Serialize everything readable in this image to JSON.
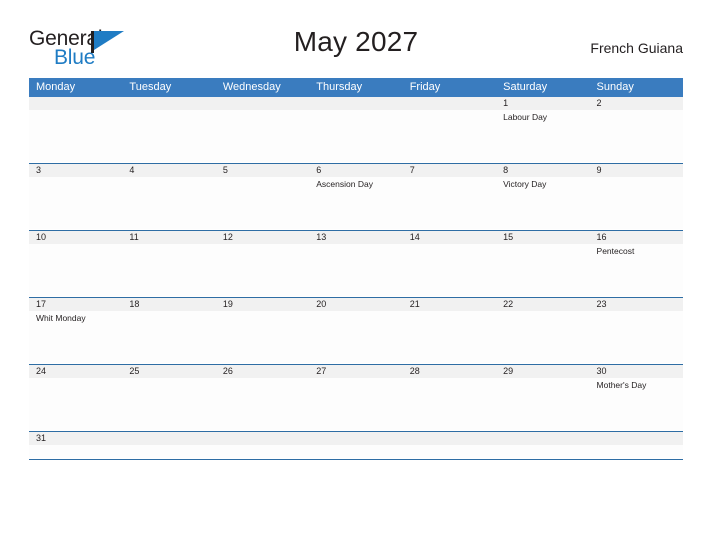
{
  "brand": {
    "name_part1": "General",
    "name_part2": "Blue",
    "flag_icon": "flag-triangle-icon",
    "accent_color": "#1f7cc4"
  },
  "header": {
    "title": "May 2027",
    "location": "French Guiana"
  },
  "theme": {
    "header_blue": "#3a7cbf",
    "row_border_blue": "#2e6da4",
    "date_band_gray": "#f1f1f1",
    "text_color": "#231f20"
  },
  "calendar": {
    "month": "May",
    "year": "2027",
    "weekday_headers": [
      "Monday",
      "Tuesday",
      "Wednesday",
      "Thursday",
      "Friday",
      "Saturday",
      "Sunday"
    ],
    "weeks": [
      {
        "days": [
          {
            "date": "",
            "event": ""
          },
          {
            "date": "",
            "event": ""
          },
          {
            "date": "",
            "event": ""
          },
          {
            "date": "",
            "event": ""
          },
          {
            "date": "",
            "event": ""
          },
          {
            "date": "1",
            "event": "Labour Day"
          },
          {
            "date": "2",
            "event": ""
          }
        ]
      },
      {
        "days": [
          {
            "date": "3",
            "event": ""
          },
          {
            "date": "4",
            "event": ""
          },
          {
            "date": "5",
            "event": ""
          },
          {
            "date": "6",
            "event": "Ascension Day"
          },
          {
            "date": "7",
            "event": ""
          },
          {
            "date": "8",
            "event": "Victory Day"
          },
          {
            "date": "9",
            "event": ""
          }
        ]
      },
      {
        "days": [
          {
            "date": "10",
            "event": ""
          },
          {
            "date": "11",
            "event": ""
          },
          {
            "date": "12",
            "event": ""
          },
          {
            "date": "13",
            "event": ""
          },
          {
            "date": "14",
            "event": ""
          },
          {
            "date": "15",
            "event": ""
          },
          {
            "date": "16",
            "event": "Pentecost"
          }
        ]
      },
      {
        "days": [
          {
            "date": "17",
            "event": "Whit Monday"
          },
          {
            "date": "18",
            "event": ""
          },
          {
            "date": "19",
            "event": ""
          },
          {
            "date": "20",
            "event": ""
          },
          {
            "date": "21",
            "event": ""
          },
          {
            "date": "22",
            "event": ""
          },
          {
            "date": "23",
            "event": ""
          }
        ]
      },
      {
        "days": [
          {
            "date": "24",
            "event": ""
          },
          {
            "date": "25",
            "event": ""
          },
          {
            "date": "26",
            "event": ""
          },
          {
            "date": "27",
            "event": ""
          },
          {
            "date": "28",
            "event": ""
          },
          {
            "date": "29",
            "event": ""
          },
          {
            "date": "30",
            "event": "Mother's Day"
          }
        ]
      },
      {
        "days": [
          {
            "date": "31",
            "event": ""
          },
          {
            "date": "",
            "event": ""
          },
          {
            "date": "",
            "event": ""
          },
          {
            "date": "",
            "event": ""
          },
          {
            "date": "",
            "event": ""
          },
          {
            "date": "",
            "event": ""
          },
          {
            "date": "",
            "event": ""
          }
        ]
      }
    ]
  }
}
